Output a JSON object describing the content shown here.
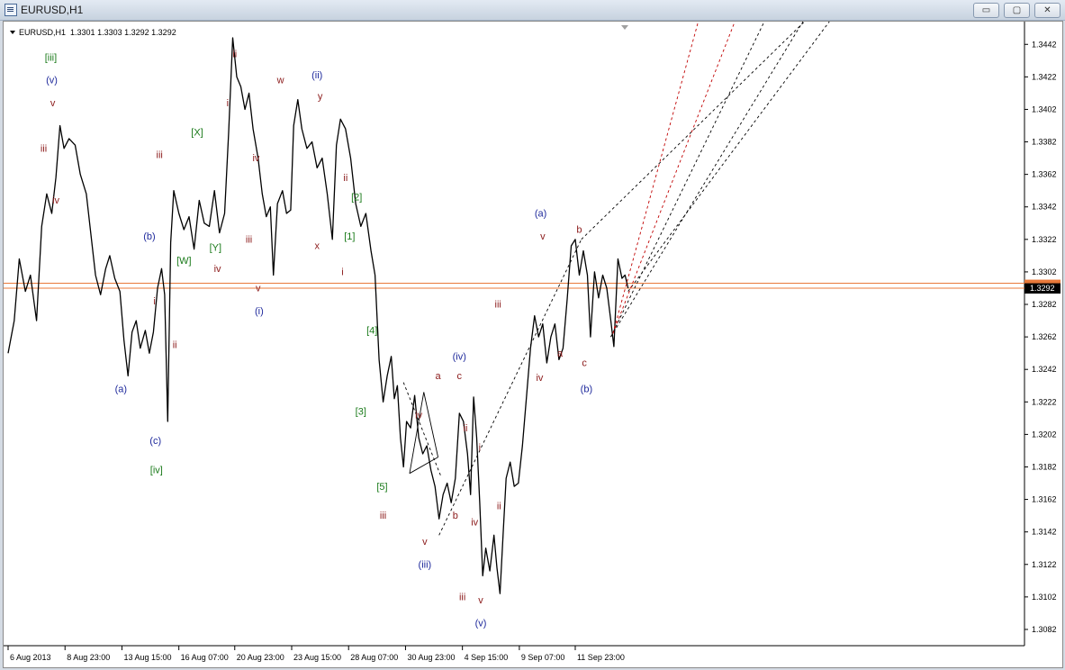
{
  "window": {
    "title": "EURUSD,H1",
    "minimize": "▭",
    "restore": "▢",
    "close": "✕"
  },
  "colors": {
    "price": "#000000",
    "grid": "#ffffff",
    "hline": "#e8793a",
    "waveBrown": "#8b1a1a",
    "waveBlue": "#1f2a9c",
    "waveGreen": "#1a7a1a",
    "channel": "#000000",
    "redChannel": "#c00000",
    "bidBg": "#000000"
  },
  "chart_data": {
    "type": "line",
    "title": "EURUSD,H1",
    "ohlc_label": {
      "open": "1.3301",
      "high": "1.3303",
      "low": "1.3292",
      "close": "1.3292"
    },
    "current_price_label": "1.3292",
    "hidden_price_label": "1.3295",
    "ylim": [
      1.3072,
      1.3456
    ],
    "xlim": [
      0,
      100
    ],
    "y_ticks": [
      "1.3442",
      "1.3422",
      "1.3402",
      "1.3382",
      "1.3362",
      "1.3342",
      "1.3322",
      "1.3302",
      "1.3282",
      "1.3262",
      "1.3242",
      "1.3222",
      "1.3202",
      "1.3182",
      "1.3162",
      "1.3142",
      "1.3122",
      "1.3102",
      "1.3082"
    ],
    "x_ticks": [
      {
        "label": "6 Aug 2013",
        "x": 0
      },
      {
        "label": "8 Aug 23:00",
        "x": 5.6
      },
      {
        "label": "13 Aug 15:00",
        "x": 11.2
      },
      {
        "label": "16 Aug 07:00",
        "x": 16.8
      },
      {
        "label": "20 Aug 23:00",
        "x": 22.3
      },
      {
        "label": "23 Aug 15:00",
        "x": 27.9
      },
      {
        "label": "28 Aug 07:00",
        "x": 33.5
      },
      {
        "label": "30 Aug 23:00",
        "x": 39.1
      },
      {
        "label": "4 Sep 15:00",
        "x": 44.7
      },
      {
        "label": "9 Sep 07:00",
        "x": 50.3
      },
      {
        "label": "11 Sep 23:00",
        "x": 55.8
      }
    ],
    "price_path": [
      [
        0,
        1.3252
      ],
      [
        0.6,
        1.3272
      ],
      [
        1.1,
        1.331
      ],
      [
        1.7,
        1.329
      ],
      [
        2.2,
        1.33
      ],
      [
        2.8,
        1.3272
      ],
      [
        3.3,
        1.333
      ],
      [
        3.8,
        1.335
      ],
      [
        4.3,
        1.3338
      ],
      [
        4.7,
        1.336
      ],
      [
        5.1,
        1.3392
      ],
      [
        5.5,
        1.3378
      ],
      [
        6.0,
        1.3384
      ],
      [
        6.6,
        1.338
      ],
      [
        7.1,
        1.3362
      ],
      [
        7.7,
        1.335
      ],
      [
        8.2,
        1.3322
      ],
      [
        8.6,
        1.33
      ],
      [
        9.1,
        1.3288
      ],
      [
        9.6,
        1.3304
      ],
      [
        10.0,
        1.3312
      ],
      [
        10.5,
        1.3298
      ],
      [
        11.0,
        1.329
      ],
      [
        11.4,
        1.326
      ],
      [
        11.8,
        1.3238
      ],
      [
        12.2,
        1.3265
      ],
      [
        12.6,
        1.3272
      ],
      [
        13.0,
        1.3255
      ],
      [
        13.5,
        1.3266
      ],
      [
        13.9,
        1.3252
      ],
      [
        14.3,
        1.3265
      ],
      [
        14.7,
        1.3292
      ],
      [
        15.1,
        1.3304
      ],
      [
        15.4,
        1.3288
      ],
      [
        15.7,
        1.321
      ],
      [
        16.0,
        1.332
      ],
      [
        16.3,
        1.3352
      ],
      [
        16.8,
        1.3338
      ],
      [
        17.3,
        1.3328
      ],
      [
        17.8,
        1.3336
      ],
      [
        18.3,
        1.3316
      ],
      [
        18.8,
        1.3346
      ],
      [
        19.3,
        1.3332
      ],
      [
        19.8,
        1.333
      ],
      [
        20.3,
        1.3352
      ],
      [
        20.8,
        1.3326
      ],
      [
        21.3,
        1.3338
      ],
      [
        21.7,
        1.3388
      ],
      [
        22.1,
        1.3446
      ],
      [
        22.5,
        1.3422
      ],
      [
        22.9,
        1.3416
      ],
      [
        23.3,
        1.3402
      ],
      [
        23.7,
        1.3412
      ],
      [
        24.1,
        1.339
      ],
      [
        24.6,
        1.3372
      ],
      [
        25.0,
        1.335
      ],
      [
        25.4,
        1.3336
      ],
      [
        25.8,
        1.3342
      ],
      [
        26.1,
        1.33
      ],
      [
        26.5,
        1.3344
      ],
      [
        27.0,
        1.3352
      ],
      [
        27.4,
        1.3338
      ],
      [
        27.8,
        1.334
      ],
      [
        28.1,
        1.3392
      ],
      [
        28.5,
        1.3408
      ],
      [
        28.9,
        1.339
      ],
      [
        29.4,
        1.3378
      ],
      [
        29.9,
        1.3382
      ],
      [
        30.4,
        1.3366
      ],
      [
        30.9,
        1.3372
      ],
      [
        31.4,
        1.335
      ],
      [
        31.9,
        1.3322
      ],
      [
        32.3,
        1.338
      ],
      [
        32.7,
        1.3396
      ],
      [
        33.2,
        1.339
      ],
      [
        33.7,
        1.3372
      ],
      [
        34.2,
        1.3344
      ],
      [
        34.7,
        1.333
      ],
      [
        35.2,
        1.3338
      ],
      [
        35.7,
        1.3315
      ],
      [
        36.1,
        1.33
      ],
      [
        36.5,
        1.3248
      ],
      [
        36.9,
        1.3222
      ],
      [
        37.3,
        1.3238
      ],
      [
        37.7,
        1.325
      ],
      [
        38.0,
        1.3224
      ],
      [
        38.3,
        1.3232
      ],
      [
        38.6,
        1.32
      ],
      [
        38.9,
        1.3182
      ],
      [
        39.2,
        1.321
      ],
      [
        39.6,
        1.3206
      ],
      [
        40.0,
        1.3226
      ],
      [
        40.4,
        1.32
      ],
      [
        40.8,
        1.319
      ],
      [
        41.2,
        1.3195
      ],
      [
        41.6,
        1.318
      ],
      [
        42.0,
        1.317
      ],
      [
        42.4,
        1.315
      ],
      [
        42.8,
        1.3165
      ],
      [
        43.2,
        1.3172
      ],
      [
        43.6,
        1.316
      ],
      [
        44.0,
        1.3175
      ],
      [
        44.4,
        1.3215
      ],
      [
        44.8,
        1.321
      ],
      [
        45.2,
        1.319
      ],
      [
        45.5,
        1.3165
      ],
      [
        45.8,
        1.3225
      ],
      [
        46.1,
        1.32
      ],
      [
        46.4,
        1.316
      ],
      [
        46.7,
        1.3115
      ],
      [
        47.0,
        1.3132
      ],
      [
        47.4,
        1.3118
      ],
      [
        47.8,
        1.314
      ],
      [
        48.1,
        1.312
      ],
      [
        48.4,
        1.3104
      ],
      [
        48.7,
        1.314
      ],
      [
        49.0,
        1.3175
      ],
      [
        49.4,
        1.3185
      ],
      [
        49.8,
        1.317
      ],
      [
        50.2,
        1.3172
      ],
      [
        50.6,
        1.3195
      ],
      [
        51.0,
        1.3225
      ],
      [
        51.4,
        1.3255
      ],
      [
        51.8,
        1.3275
      ],
      [
        52.2,
        1.3262
      ],
      [
        52.6,
        1.327
      ],
      [
        53.0,
        1.3246
      ],
      [
        53.4,
        1.3262
      ],
      [
        53.8,
        1.327
      ],
      [
        54.2,
        1.3248
      ],
      [
        54.6,
        1.3255
      ],
      [
        55.0,
        1.3285
      ],
      [
        55.4,
        1.3318
      ],
      [
        55.8,
        1.3322
      ],
      [
        56.2,
        1.33
      ],
      [
        56.6,
        1.3315
      ],
      [
        57.0,
        1.33
      ],
      [
        57.3,
        1.3262
      ],
      [
        57.7,
        1.3302
      ],
      [
        58.1,
        1.3286
      ],
      [
        58.5,
        1.33
      ],
      [
        58.9,
        1.3292
      ],
      [
        59.3,
        1.3272
      ],
      [
        59.6,
        1.3256
      ],
      [
        60.0,
        1.331
      ],
      [
        60.4,
        1.3298
      ],
      [
        60.7,
        1.33
      ],
      [
        61.0,
        1.3292
      ]
    ],
    "horizontal_lines": [
      1.3295,
      1.3292
    ],
    "trend_lines": [
      {
        "style": "solid",
        "color": "channel",
        "x1": 39.5,
        "y1": 1.3178,
        "x2": 42.3,
        "y2": 1.3188
      },
      {
        "style": "solid",
        "color": "channel",
        "x1": 39.5,
        "y1": 1.3178,
        "x2": 40.9,
        "y2": 1.3228
      },
      {
        "style": "solid",
        "color": "channel",
        "x1": 40.9,
        "y1": 1.3228,
        "x2": 42.3,
        "y2": 1.3188
      },
      {
        "style": "dashed",
        "color": "channel",
        "x1": 38.9,
        "y1": 1.3234,
        "x2": 42.6,
        "y2": 1.3176
      },
      {
        "style": "dashed",
        "color": "channel",
        "x1": 42.4,
        "y1": 1.314,
        "x2": 56.4,
        "y2": 1.3322
      },
      {
        "style": "dashed",
        "color": "channel",
        "x1": 56.4,
        "y1": 1.3322,
        "x2": 79.5,
        "y2": 1.3463
      },
      {
        "style": "dashed",
        "color": "channel",
        "x1": 59.3,
        "y1": 1.3262,
        "x2": 78.2,
        "y2": 1.3456
      },
      {
        "style": "dashed",
        "color": "channel",
        "x1": 59.3,
        "y1": 1.3262,
        "x2": 74.4,
        "y2": 1.3456
      },
      {
        "style": "dashed",
        "color": "channel",
        "x1": 61.0,
        "y1": 1.329,
        "x2": 80.8,
        "y2": 1.3456
      },
      {
        "style": "dashed",
        "color": "redChannel",
        "x1": 59.5,
        "y1": 1.3264,
        "x2": 71.5,
        "y2": 1.3456
      },
      {
        "style": "dashed",
        "color": "redChannel",
        "x1": 59.5,
        "y1": 1.3264,
        "x2": 67.9,
        "y2": 1.3456
      }
    ],
    "wave_labels": [
      {
        "text": "[iii]",
        "x": 4.2,
        "y": 1.3432,
        "color": "waveGreen"
      },
      {
        "text": "(v)",
        "x": 4.3,
        "y": 1.3418,
        "color": "waveBlue"
      },
      {
        "text": "v",
        "x": 4.4,
        "y": 1.3404,
        "color": "waveBrown"
      },
      {
        "text": "iii",
        "x": 3.5,
        "y": 1.3376,
        "color": "waveBrown"
      },
      {
        "text": "iv",
        "x": 4.7,
        "y": 1.3344,
        "color": "waveBrown"
      },
      {
        "text": "(a)",
        "x": 11.1,
        "y": 1.3228,
        "color": "waveBlue"
      },
      {
        "text": "(b)",
        "x": 13.9,
        "y": 1.3322,
        "color": "waveBlue"
      },
      {
        "text": "i",
        "x": 14.4,
        "y": 1.3282,
        "color": "waveBrown"
      },
      {
        "text": "ii",
        "x": 16.4,
        "y": 1.3255,
        "color": "waveBrown"
      },
      {
        "text": "(c)",
        "x": 14.5,
        "y": 1.3196,
        "color": "waveBlue"
      },
      {
        "text": "[iv]",
        "x": 14.6,
        "y": 1.3178,
        "color": "waveGreen"
      },
      {
        "text": "iii",
        "x": 14.9,
        "y": 1.3372,
        "color": "waveBrown"
      },
      {
        "text": "[X]",
        "x": 18.6,
        "y": 1.3386,
        "color": "waveGreen"
      },
      {
        "text": "[W]",
        "x": 17.3,
        "y": 1.3307,
        "color": "waveGreen"
      },
      {
        "text": "[Y]",
        "x": 20.4,
        "y": 1.3315,
        "color": "waveGreen"
      },
      {
        "text": "iv",
        "x": 20.6,
        "y": 1.3302,
        "color": "waveBrown"
      },
      {
        "text": "ii",
        "x": 22.3,
        "y": 1.3434,
        "color": "waveBrown"
      },
      {
        "text": "i",
        "x": 21.6,
        "y": 1.3404,
        "color": "waveBrown"
      },
      {
        "text": "iv",
        "x": 24.4,
        "y": 1.337,
        "color": "waveBrown"
      },
      {
        "text": "iii",
        "x": 23.7,
        "y": 1.332,
        "color": "waveBrown"
      },
      {
        "text": "v",
        "x": 24.6,
        "y": 1.329,
        "color": "waveBrown"
      },
      {
        "text": "(i)",
        "x": 24.7,
        "y": 1.3276,
        "color": "waveBlue"
      },
      {
        "text": "w",
        "x": 26.8,
        "y": 1.3418,
        "color": "waveBrown"
      },
      {
        "text": "(ii)",
        "x": 30.4,
        "y": 1.3421,
        "color": "waveBlue"
      },
      {
        "text": "y",
        "x": 30.7,
        "y": 1.3408,
        "color": "waveBrown"
      },
      {
        "text": "x",
        "x": 30.4,
        "y": 1.3316,
        "color": "waveBrown"
      },
      {
        "text": "ii",
        "x": 33.2,
        "y": 1.3358,
        "color": "waveBrown"
      },
      {
        "text": "[2]",
        "x": 34.3,
        "y": 1.3346,
        "color": "waveGreen"
      },
      {
        "text": "[1]",
        "x": 33.6,
        "y": 1.3322,
        "color": "waveGreen"
      },
      {
        "text": "i",
        "x": 32.9,
        "y": 1.33,
        "color": "waveBrown"
      },
      {
        "text": "[4]",
        "x": 35.8,
        "y": 1.3264,
        "color": "waveGreen"
      },
      {
        "text": "[3]",
        "x": 34.7,
        "y": 1.3214,
        "color": "waveGreen"
      },
      {
        "text": "[5]",
        "x": 36.8,
        "y": 1.3168,
        "color": "waveGreen"
      },
      {
        "text": "iii",
        "x": 36.9,
        "y": 1.315,
        "color": "waveBrown"
      },
      {
        "text": "iv",
        "x": 40.4,
        "y": 1.3212,
        "color": "waveBrown"
      },
      {
        "text": "v",
        "x": 41.0,
        "y": 1.3134,
        "color": "waveBrown"
      },
      {
        "text": "(iii)",
        "x": 41.0,
        "y": 1.312,
        "color": "waveBlue"
      },
      {
        "text": "a",
        "x": 42.3,
        "y": 1.3236,
        "color": "waveBrown"
      },
      {
        "text": "(iv)",
        "x": 44.4,
        "y": 1.3248,
        "color": "waveBlue"
      },
      {
        "text": "c",
        "x": 44.4,
        "y": 1.3236,
        "color": "waveBrown"
      },
      {
        "text": "ii",
        "x": 45.0,
        "y": 1.3204,
        "color": "waveBrown"
      },
      {
        "text": "i",
        "x": 46.4,
        "y": 1.3192,
        "color": "waveBrown"
      },
      {
        "text": "b",
        "x": 44.0,
        "y": 1.315,
        "color": "waveBrown"
      },
      {
        "text": "iv",
        "x": 45.9,
        "y": 1.3146,
        "color": "waveBrown"
      },
      {
        "text": "ii",
        "x": 48.3,
        "y": 1.3156,
        "color": "waveBrown"
      },
      {
        "text": "iii",
        "x": 44.7,
        "y": 1.31,
        "color": "waveBrown"
      },
      {
        "text": "v",
        "x": 46.5,
        "y": 1.3098,
        "color": "waveBrown"
      },
      {
        "text": "(v)",
        "x": 46.5,
        "y": 1.3084,
        "color": "waveBlue"
      },
      {
        "text": "iii",
        "x": 48.2,
        "y": 1.328,
        "color": "waveBrown"
      },
      {
        "text": "(a)",
        "x": 52.4,
        "y": 1.3336,
        "color": "waveBlue"
      },
      {
        "text": "v",
        "x": 52.6,
        "y": 1.3322,
        "color": "waveBrown"
      },
      {
        "text": "b",
        "x": 56.2,
        "y": 1.3326,
        "color": "waveBrown"
      },
      {
        "text": "iv",
        "x": 52.3,
        "y": 1.3235,
        "color": "waveBrown"
      },
      {
        "text": "a",
        "x": 54.3,
        "y": 1.325,
        "color": "waveBrown"
      },
      {
        "text": "c",
        "x": 56.7,
        "y": 1.3244,
        "color": "waveBrown"
      },
      {
        "text": "(b)",
        "x": 56.9,
        "y": 1.3228,
        "color": "waveBlue"
      }
    ]
  }
}
